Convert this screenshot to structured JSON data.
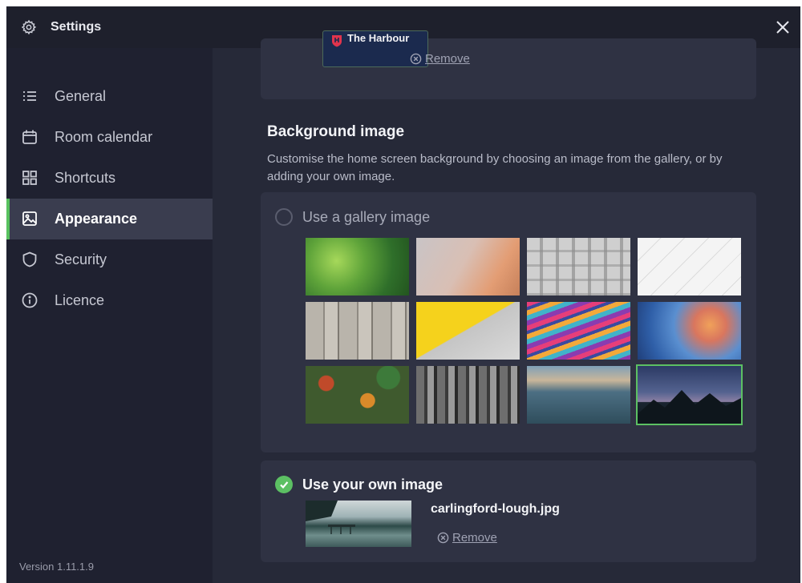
{
  "window": {
    "title": "Settings",
    "title_icon": "gear-icon",
    "close_icon": "close-icon"
  },
  "sidebar": {
    "items": [
      {
        "label": "General",
        "icon": "list-icon"
      },
      {
        "label": "Room calendar",
        "icon": "calendar-icon"
      },
      {
        "label": "Shortcuts",
        "icon": "grid-icon"
      },
      {
        "label": "Appearance",
        "icon": "image-icon",
        "active": true
      },
      {
        "label": "Security",
        "icon": "shield-icon"
      },
      {
        "label": "Licence",
        "icon": "info-icon"
      }
    ],
    "version": "Version 1.11.1.9"
  },
  "logo_section": {
    "logo_text": "The Harbour",
    "remove_label": "Remove"
  },
  "background_section": {
    "heading": "Background image",
    "description": "Customise the home screen background by choosing an image from the gallery, or by adding your own image.",
    "gallery_option": {
      "label": "Use a gallery image",
      "selected": false
    },
    "gallery_images": [
      {
        "name": "green-leaves"
      },
      {
        "name": "blurred-peach-gradient"
      },
      {
        "name": "white-concrete-pattern"
      },
      {
        "name": "white-tiles"
      },
      {
        "name": "wooden-planks"
      },
      {
        "name": "yellow-grey-diagonal"
      },
      {
        "name": "colorful-paint-swirl"
      },
      {
        "name": "abstract-blue-orange-paint"
      },
      {
        "name": "autumn-trees-aerial"
      },
      {
        "name": "city-skyline-bw"
      },
      {
        "name": "rocky-coast"
      },
      {
        "name": "mountains-night-sky",
        "selected": true
      }
    ],
    "own_option": {
      "label": "Use your own image",
      "selected": true,
      "filename": "carlingford-lough.jpg",
      "remove_label": "Remove"
    }
  },
  "colors": {
    "accent_green": "#5cc063",
    "sidebar_bg": "#1f2130",
    "content_bg": "#262938",
    "card_bg": "#2f3243"
  }
}
